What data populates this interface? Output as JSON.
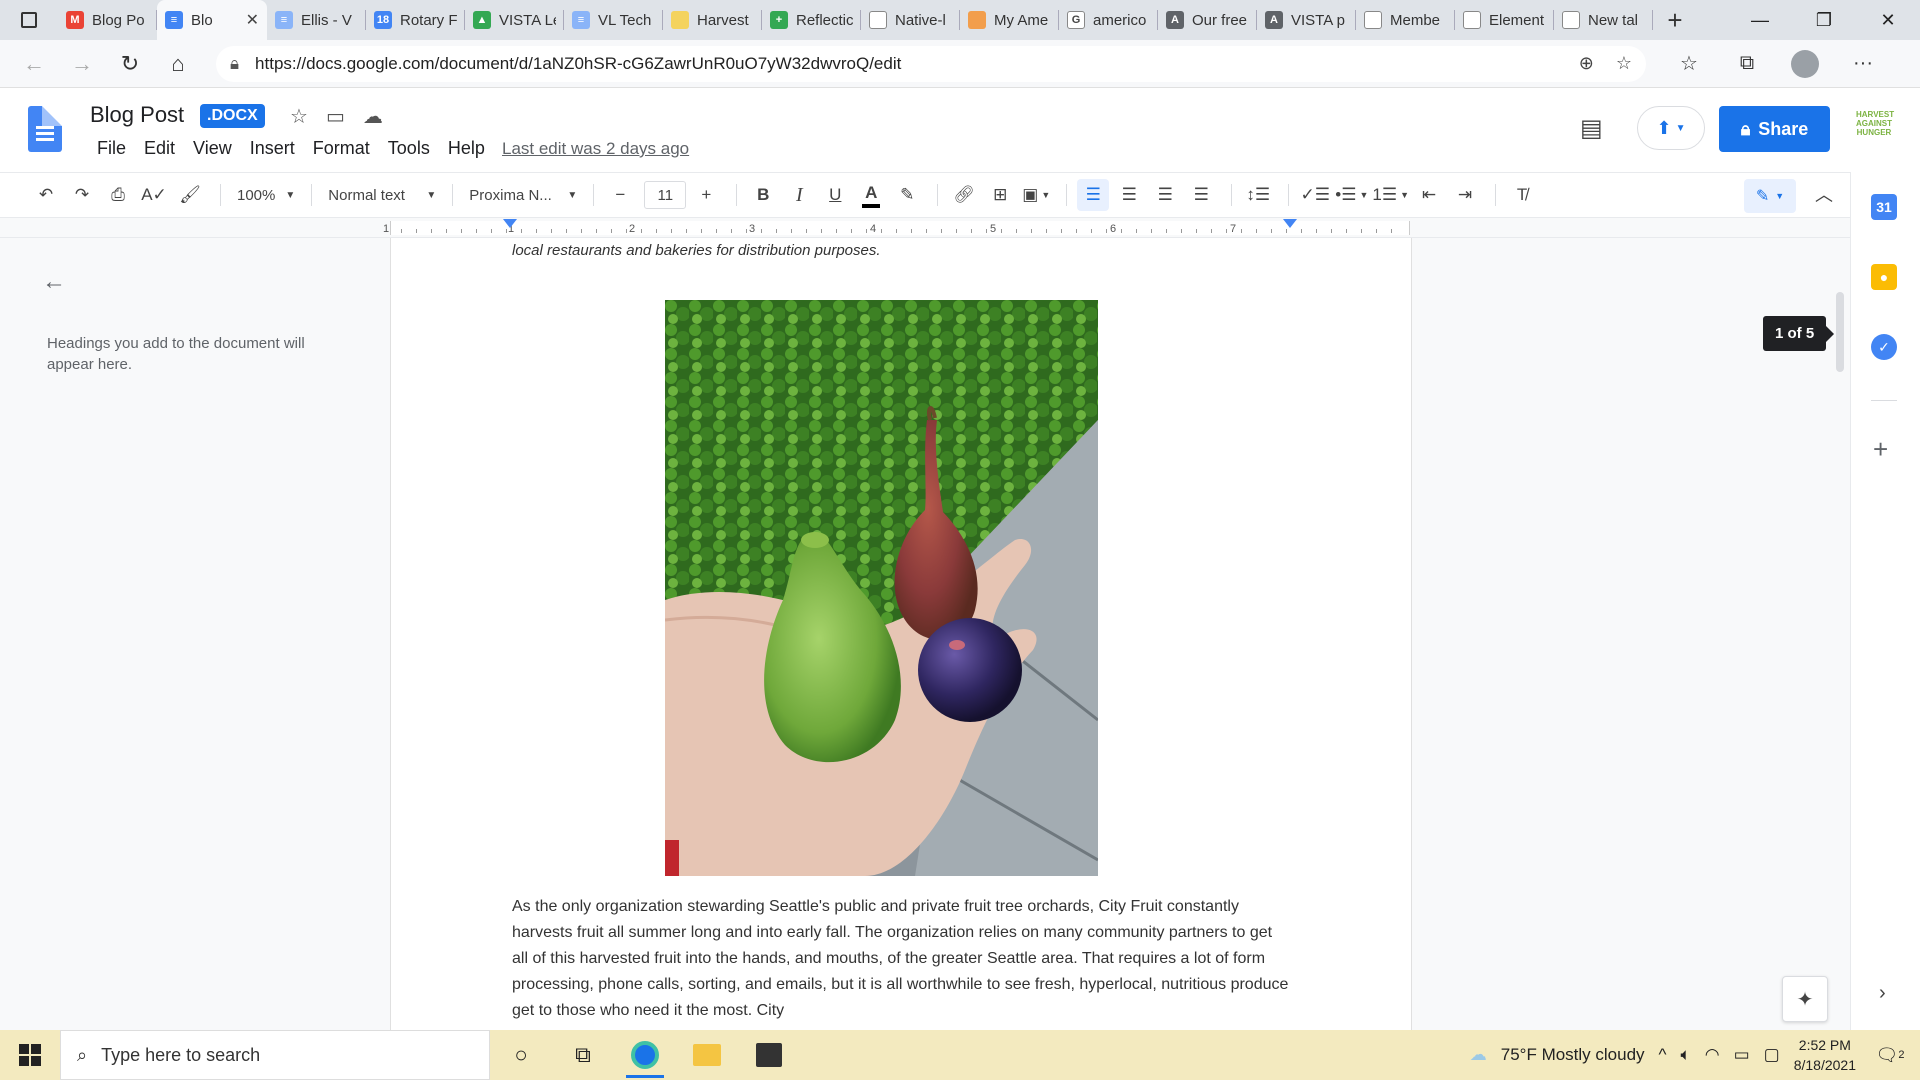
{
  "browser": {
    "tabs": [
      {
        "label": "Blog Po",
        "icon": "gmail-icon",
        "color": "#ea4335",
        "glyph": "M",
        "active": false
      },
      {
        "label": "Blo",
        "icon": "docs-icon",
        "color": "#4285f4",
        "glyph": "≡",
        "active": true
      },
      {
        "label": "Ellis - V",
        "icon": "docs-icon",
        "color": "#8ab4f8",
        "glyph": "≡",
        "active": false
      },
      {
        "label": "Rotary F",
        "icon": "calendar-icon",
        "color": "#4285f4",
        "glyph": "18",
        "active": false
      },
      {
        "label": "VISTA Le",
        "icon": "drive-icon",
        "color": "#34a853",
        "glyph": "▲",
        "active": false
      },
      {
        "label": "VL Tech",
        "icon": "docs-icon",
        "color": "#8ab4f8",
        "glyph": "≡",
        "active": false
      },
      {
        "label": "Harvest",
        "icon": "folder-icon",
        "color": "#f4d35e",
        "glyph": "",
        "active": false
      },
      {
        "label": "Reflectic",
        "icon": "sheets-icon",
        "color": "#34a853",
        "glyph": "+",
        "active": false
      },
      {
        "label": "Native-l",
        "icon": "page-icon",
        "color": "#ffffff",
        "glyph": "",
        "active": false
      },
      {
        "label": "My Ame",
        "icon": "americorps-icon",
        "color": "#f29e4c",
        "glyph": "",
        "active": false
      },
      {
        "label": "americo",
        "icon": "google-icon",
        "color": "#ffffff",
        "glyph": "G",
        "active": false
      },
      {
        "label": "Our free",
        "icon": "site-icon",
        "color": "#5f6368",
        "glyph": "A",
        "active": false
      },
      {
        "label": "VISTA p",
        "icon": "site-icon",
        "color": "#5f6368",
        "glyph": "A",
        "active": false
      },
      {
        "label": "Membe",
        "icon": "page-icon",
        "color": "#ffffff",
        "glyph": "",
        "active": false
      },
      {
        "label": "Element",
        "icon": "page-icon",
        "color": "#ffffff",
        "glyph": "",
        "active": false
      },
      {
        "label": "New tal",
        "icon": "newtab-icon",
        "color": "#ffffff",
        "glyph": "",
        "active": false
      }
    ],
    "url": "https://docs.google.com/document/d/1aNZ0hSR-cG6ZawrUnR0uO7yW32dwvroQ/edit"
  },
  "docs": {
    "title": "Blog Post",
    "badge": ".DOCX",
    "menu": [
      "File",
      "Edit",
      "View",
      "Insert",
      "Format",
      "Tools",
      "Help"
    ],
    "last_edit": "Last edit was 2 days ago",
    "share_label": "Share",
    "org_logo_text": "HARVEST AGAINST HUNGER"
  },
  "toolbar": {
    "zoom": "100%",
    "style": "Normal text",
    "font": "Proxima N...",
    "font_size": "11",
    "bold": "B",
    "italic": "I",
    "underline": "U",
    "text_color": "A"
  },
  "ruler": {
    "numbers": [
      "1",
      "1",
      "2",
      "3",
      "4",
      "5",
      "6",
      "7"
    ]
  },
  "outline": {
    "hint": "Headings you add to the document will appear here."
  },
  "document": {
    "caption": "local restaurants and bakeries for distribution purposes.",
    "body": "As the only organization stewarding Seattle's public and private fruit tree orchards, City Fruit constantly harvests fruit all summer long and into early fall. The organization relies on many community partners to get all of this harvested fruit into the hands, and mouths, of the greater Seattle area. That requires a lot of form processing, phone calls, sorting, and emails, but it is all worthwhile to see fresh, hyperlocal, nutritious produce get to those who need it the most. City"
  },
  "page_indicator": "1 of 5",
  "side_panel": {
    "calendar_day": "31"
  },
  "taskbar": {
    "search_placeholder": "Type here to search",
    "weather": "75°F  Mostly cloudy",
    "time": "2:52 PM",
    "date": "8/18/2021",
    "notifications": "2"
  }
}
